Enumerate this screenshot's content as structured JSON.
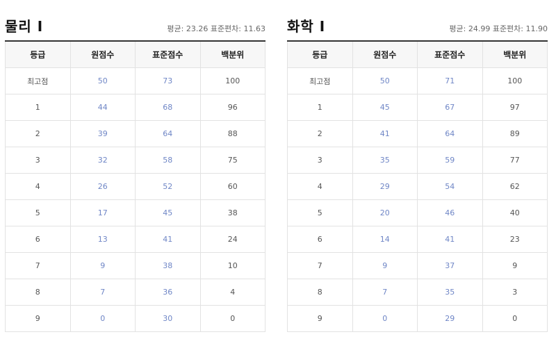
{
  "tables": [
    {
      "title": "물리 I",
      "stats": "평균: 23.26 표준편차: 11.63",
      "headers": [
        "등급",
        "원점수",
        "표준점수",
        "백분위"
      ],
      "rows": [
        [
          "최고점",
          "50",
          "73",
          "100"
        ],
        [
          "1",
          "44",
          "68",
          "96"
        ],
        [
          "2",
          "39",
          "64",
          "88"
        ],
        [
          "3",
          "32",
          "58",
          "75"
        ],
        [
          "4",
          "26",
          "52",
          "60"
        ],
        [
          "5",
          "17",
          "45",
          "38"
        ],
        [
          "6",
          "13",
          "41",
          "24"
        ],
        [
          "7",
          "9",
          "38",
          "10"
        ],
        [
          "8",
          "7",
          "36",
          "4"
        ],
        [
          "9",
          "0",
          "30",
          "0"
        ]
      ]
    },
    {
      "title": "화학 I",
      "stats": "평균: 24.99 표준편차: 11.90",
      "headers": [
        "등급",
        "원점수",
        "표준점수",
        "백분위"
      ],
      "rows": [
        [
          "최고점",
          "50",
          "71",
          "100"
        ],
        [
          "1",
          "45",
          "67",
          "97"
        ],
        [
          "2",
          "41",
          "64",
          "89"
        ],
        [
          "3",
          "35",
          "59",
          "77"
        ],
        [
          "4",
          "29",
          "54",
          "62"
        ],
        [
          "5",
          "20",
          "46",
          "40"
        ],
        [
          "6",
          "14",
          "41",
          "23"
        ],
        [
          "7",
          "9",
          "37",
          "9"
        ],
        [
          "8",
          "7",
          "35",
          "3"
        ],
        [
          "9",
          "0",
          "29",
          "0"
        ]
      ]
    }
  ],
  "colors": {
    "link_blue": "#6f86c6",
    "header_bg": "#f7f7f7",
    "border": "#e2e2e2"
  }
}
